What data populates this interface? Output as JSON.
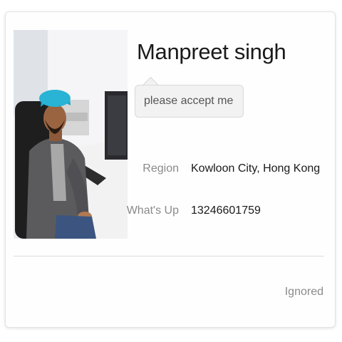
{
  "contact": {
    "name": "Manpreet singh",
    "message": "please accept me"
  },
  "details": [
    {
      "label": "Region",
      "value": "Kowloon City, Hong Kong"
    },
    {
      "label": "What's Up",
      "value": "13246601759"
    }
  ],
  "status": {
    "text": "Ignored"
  },
  "colors": {
    "text_primary": "#1a1a1a",
    "text_secondary": "#8a8a8a",
    "bubble_bg": "#f2f2f2",
    "divider": "#dcdcdc"
  }
}
